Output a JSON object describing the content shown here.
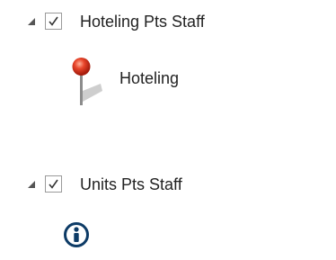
{
  "toc": {
    "layers": [
      {
        "name": "Hoteling Pts Staff",
        "checked": true,
        "expanded": true,
        "symbol": {
          "icon": "map-pin-icon",
          "label": "Hoteling",
          "color": "#e8452a"
        }
      },
      {
        "name": "Units Pts Staff",
        "checked": true,
        "expanded": true,
        "symbol": {
          "icon": "info-icon",
          "color": "#0d3b66"
        }
      }
    ]
  }
}
